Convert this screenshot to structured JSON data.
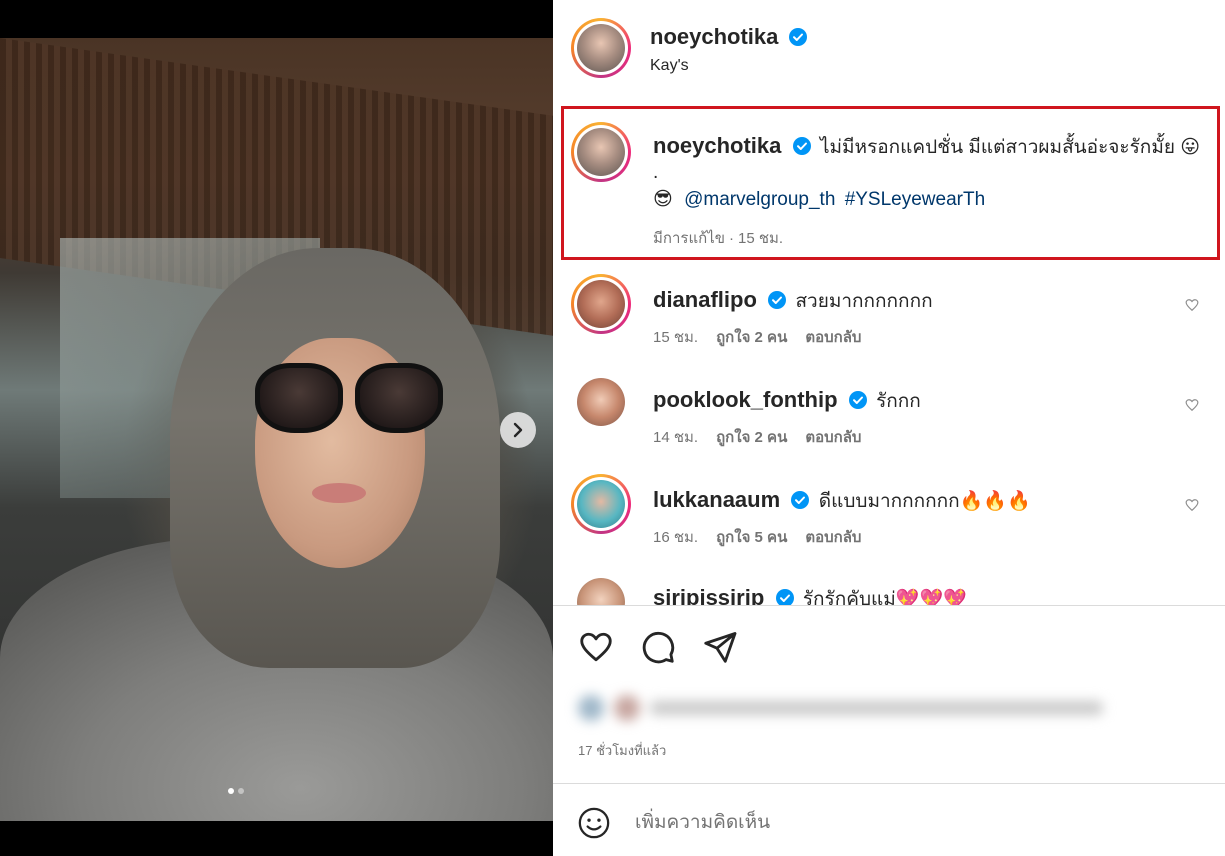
{
  "post": {
    "username": "noeychotika",
    "location": "Kay's",
    "caption": {
      "username": "noeychotika",
      "text": "ไม่มีหรอกแคปชั่น มีแต่สาวผมสั้นอ่ะจะรักมั้ย 😛",
      "dot": ".",
      "emoji": "😎",
      "mention": "@marvelgroup_th",
      "hashtag": "#YSLeyewearTh",
      "edited": "มีการแก้ไข",
      "sep": "·",
      "time": "15 ชม."
    },
    "time_ago": "17 ชั่วโมงที่แล้ว"
  },
  "comments": [
    {
      "username": "dianaflipo",
      "text": "สวยมากกกกกกก",
      "time": "15 ชม.",
      "likes": "ถูกใจ 2 คน",
      "reply": "ตอบกลับ"
    },
    {
      "username": "pooklook_fonthip",
      "text": "รักกก",
      "time": "14 ชม.",
      "likes": "ถูกใจ 2 คน",
      "reply": "ตอบกลับ"
    },
    {
      "username": "lukkanaaum",
      "text": "ดีแบบมากกกกกก🔥🔥🔥",
      "time": "16 ชม.",
      "likes": "ถูกใจ 5 คน",
      "reply": "ตอบกลับ"
    },
    {
      "username": "siripissirip",
      "text": "รักรักคับแม่💖💖💖"
    }
  ],
  "add_comment": {
    "placeholder": "เพิ่มความคิดเห็น"
  },
  "colors": {
    "highlight_border": "#d0161e",
    "verified": "#0095f6",
    "link": "#00376b"
  }
}
